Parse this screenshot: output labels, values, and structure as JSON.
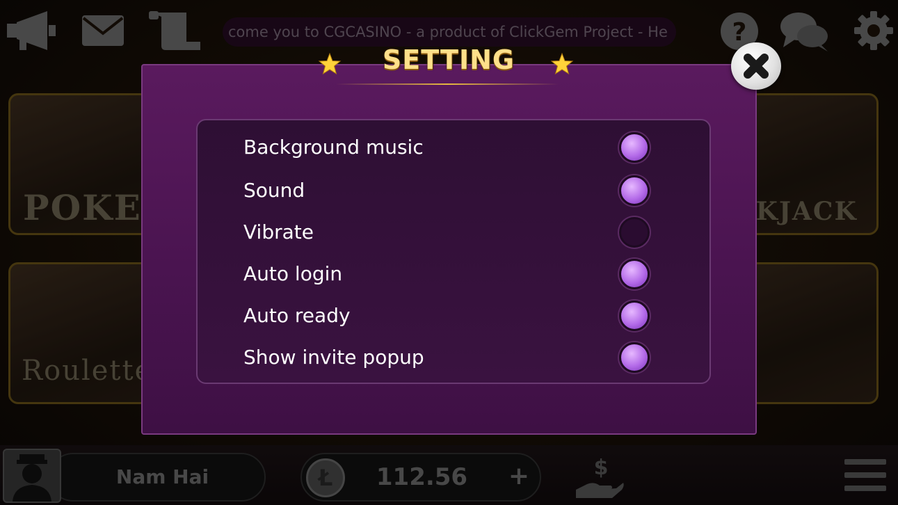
{
  "ticker": {
    "text": "come you to CGCASINO - a product of ClickGem Project - He"
  },
  "tiles": [
    {
      "title": "POKER"
    },
    {
      "title": ""
    },
    {
      "title": ""
    },
    {
      "title": "ACKJACK"
    },
    {
      "title": "Roulette"
    },
    {
      "title": ""
    },
    {
      "title": ""
    },
    {
      "title": ""
    }
  ],
  "dialog": {
    "title": "SETTING",
    "options": [
      {
        "label": "Background music",
        "enabled": true
      },
      {
        "label": "Sound",
        "enabled": true
      },
      {
        "label": "Vibrate",
        "enabled": false
      },
      {
        "label": "Auto login",
        "enabled": true
      },
      {
        "label": "Auto ready",
        "enabled": true
      },
      {
        "label": "Show invite popup",
        "enabled": true
      }
    ]
  },
  "user": {
    "name": "Nam Hai",
    "balance": "112.56",
    "coin_symbol": "Ł",
    "add_label": "+"
  },
  "icons": {
    "megaphone": "megaphone-icon",
    "mail": "mail-icon",
    "scroll": "scroll-icon",
    "help": "help-icon",
    "chat": "chat-icon",
    "gear": "gear-icon",
    "close": "close-icon",
    "cashout": "money-hand-icon",
    "menu": "hamburger-icon"
  },
  "colors": {
    "accent": "#b36ae8",
    "title_gold": "#ffe08a",
    "dialog_bg": "#4a1450"
  }
}
